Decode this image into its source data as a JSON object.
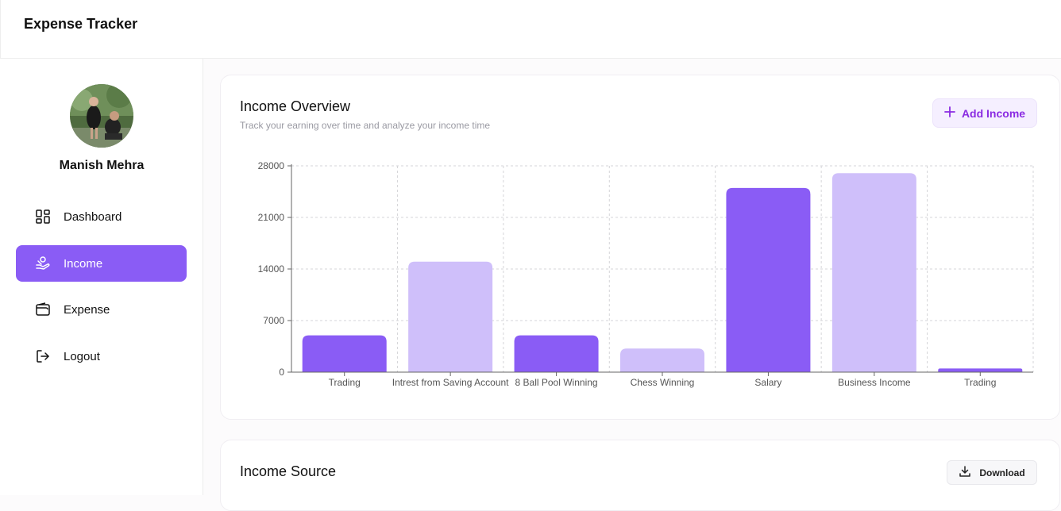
{
  "app": {
    "title": "Expense Tracker"
  },
  "user": {
    "name": "Manish Mehra"
  },
  "sidebar": {
    "items": [
      {
        "label": "Dashboard",
        "icon": "dashboard-icon",
        "active": false
      },
      {
        "label": "Income",
        "icon": "income-icon",
        "active": true
      },
      {
        "label": "Expense",
        "icon": "wallet-icon",
        "active": false
      },
      {
        "label": "Logout",
        "icon": "logout-icon",
        "active": false
      }
    ]
  },
  "overview": {
    "title": "Income Overview",
    "subtitle": "Track your earning over time and analyze your income time",
    "add_button": "Add Income"
  },
  "income_source": {
    "title": "Income Source",
    "download_button": "Download"
  },
  "colors": {
    "primary": "#8a5cf5",
    "secondary": "#cfbffa",
    "accent_text": "#8a2be2"
  },
  "chart_data": {
    "type": "bar",
    "categories": [
      "Trading",
      "Intrest from Saving Account",
      "8 Ball Pool Winning",
      "Chess Winning",
      "Salary",
      "Business Income",
      "Trading"
    ],
    "values": [
      5000,
      15000,
      5000,
      3200,
      25000,
      27000,
      500
    ],
    "bar_colors": [
      "#8a5cf5",
      "#cfbffa",
      "#8a5cf5",
      "#cfbffa",
      "#8a5cf5",
      "#cfbffa",
      "#8a5cf5"
    ],
    "yticks": [
      0,
      7000,
      14000,
      21000,
      28000
    ],
    "ylim": [
      0,
      28000
    ],
    "grid": true
  }
}
